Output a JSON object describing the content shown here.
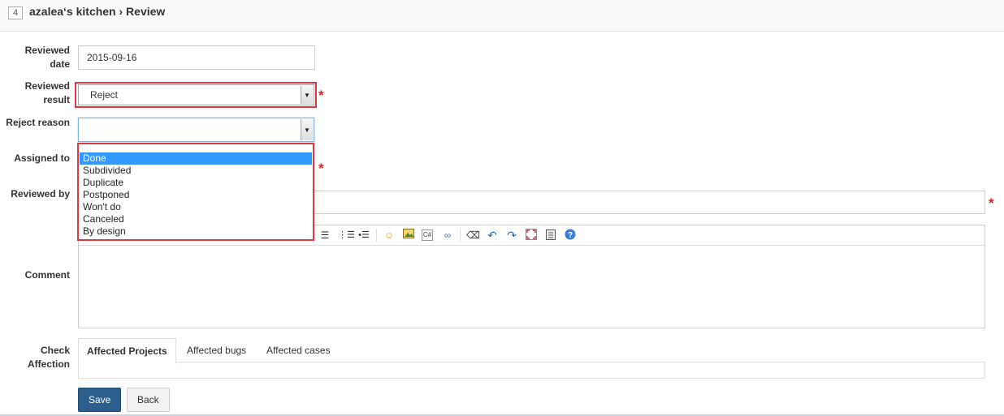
{
  "header": {
    "id": "4",
    "title": "azalea‘s kitchen › Review"
  },
  "form": {
    "reviewed_date_label": "Reviewed date",
    "reviewed_date_value": "2015-09-16",
    "reviewed_result_label": "Reviewed result",
    "reviewed_result_value": "Reject",
    "reject_reason_label": "Reject reason",
    "reject_reason_value": "",
    "assigned_to_label": "Assigned to",
    "reviewed_by_label": "Reviewed by",
    "comment_label": "Comment",
    "check_affection_label": "Check Affection",
    "required_mark": "*"
  },
  "dropdown": {
    "options": [
      "Done",
      "Subdivided",
      "Duplicate",
      "Postponed",
      "Won't do",
      "Canceled",
      "By design"
    ],
    "highlighted": "Done"
  },
  "toolbar": {
    "icons": [
      "align-right-icon",
      "ordered-list-icon",
      "unordered-list-icon",
      "emoticon-icon",
      "image-icon",
      "code-icon",
      "link-icon",
      "eraser-icon",
      "undo-icon",
      "redo-icon",
      "fullscreen-icon",
      "paste-icon",
      "help-icon"
    ]
  },
  "tabs": {
    "affected_projects": "Affected Projects",
    "affected_bugs": "Affected bugs",
    "affected_cases": "Affected cases"
  },
  "buttons": {
    "save": "Save",
    "back": "Back"
  },
  "colors": {
    "highlight": "#3399ff",
    "required": "#d9231e",
    "save_button": "#2c5f8e",
    "annotation_frame": "#e0383e"
  }
}
